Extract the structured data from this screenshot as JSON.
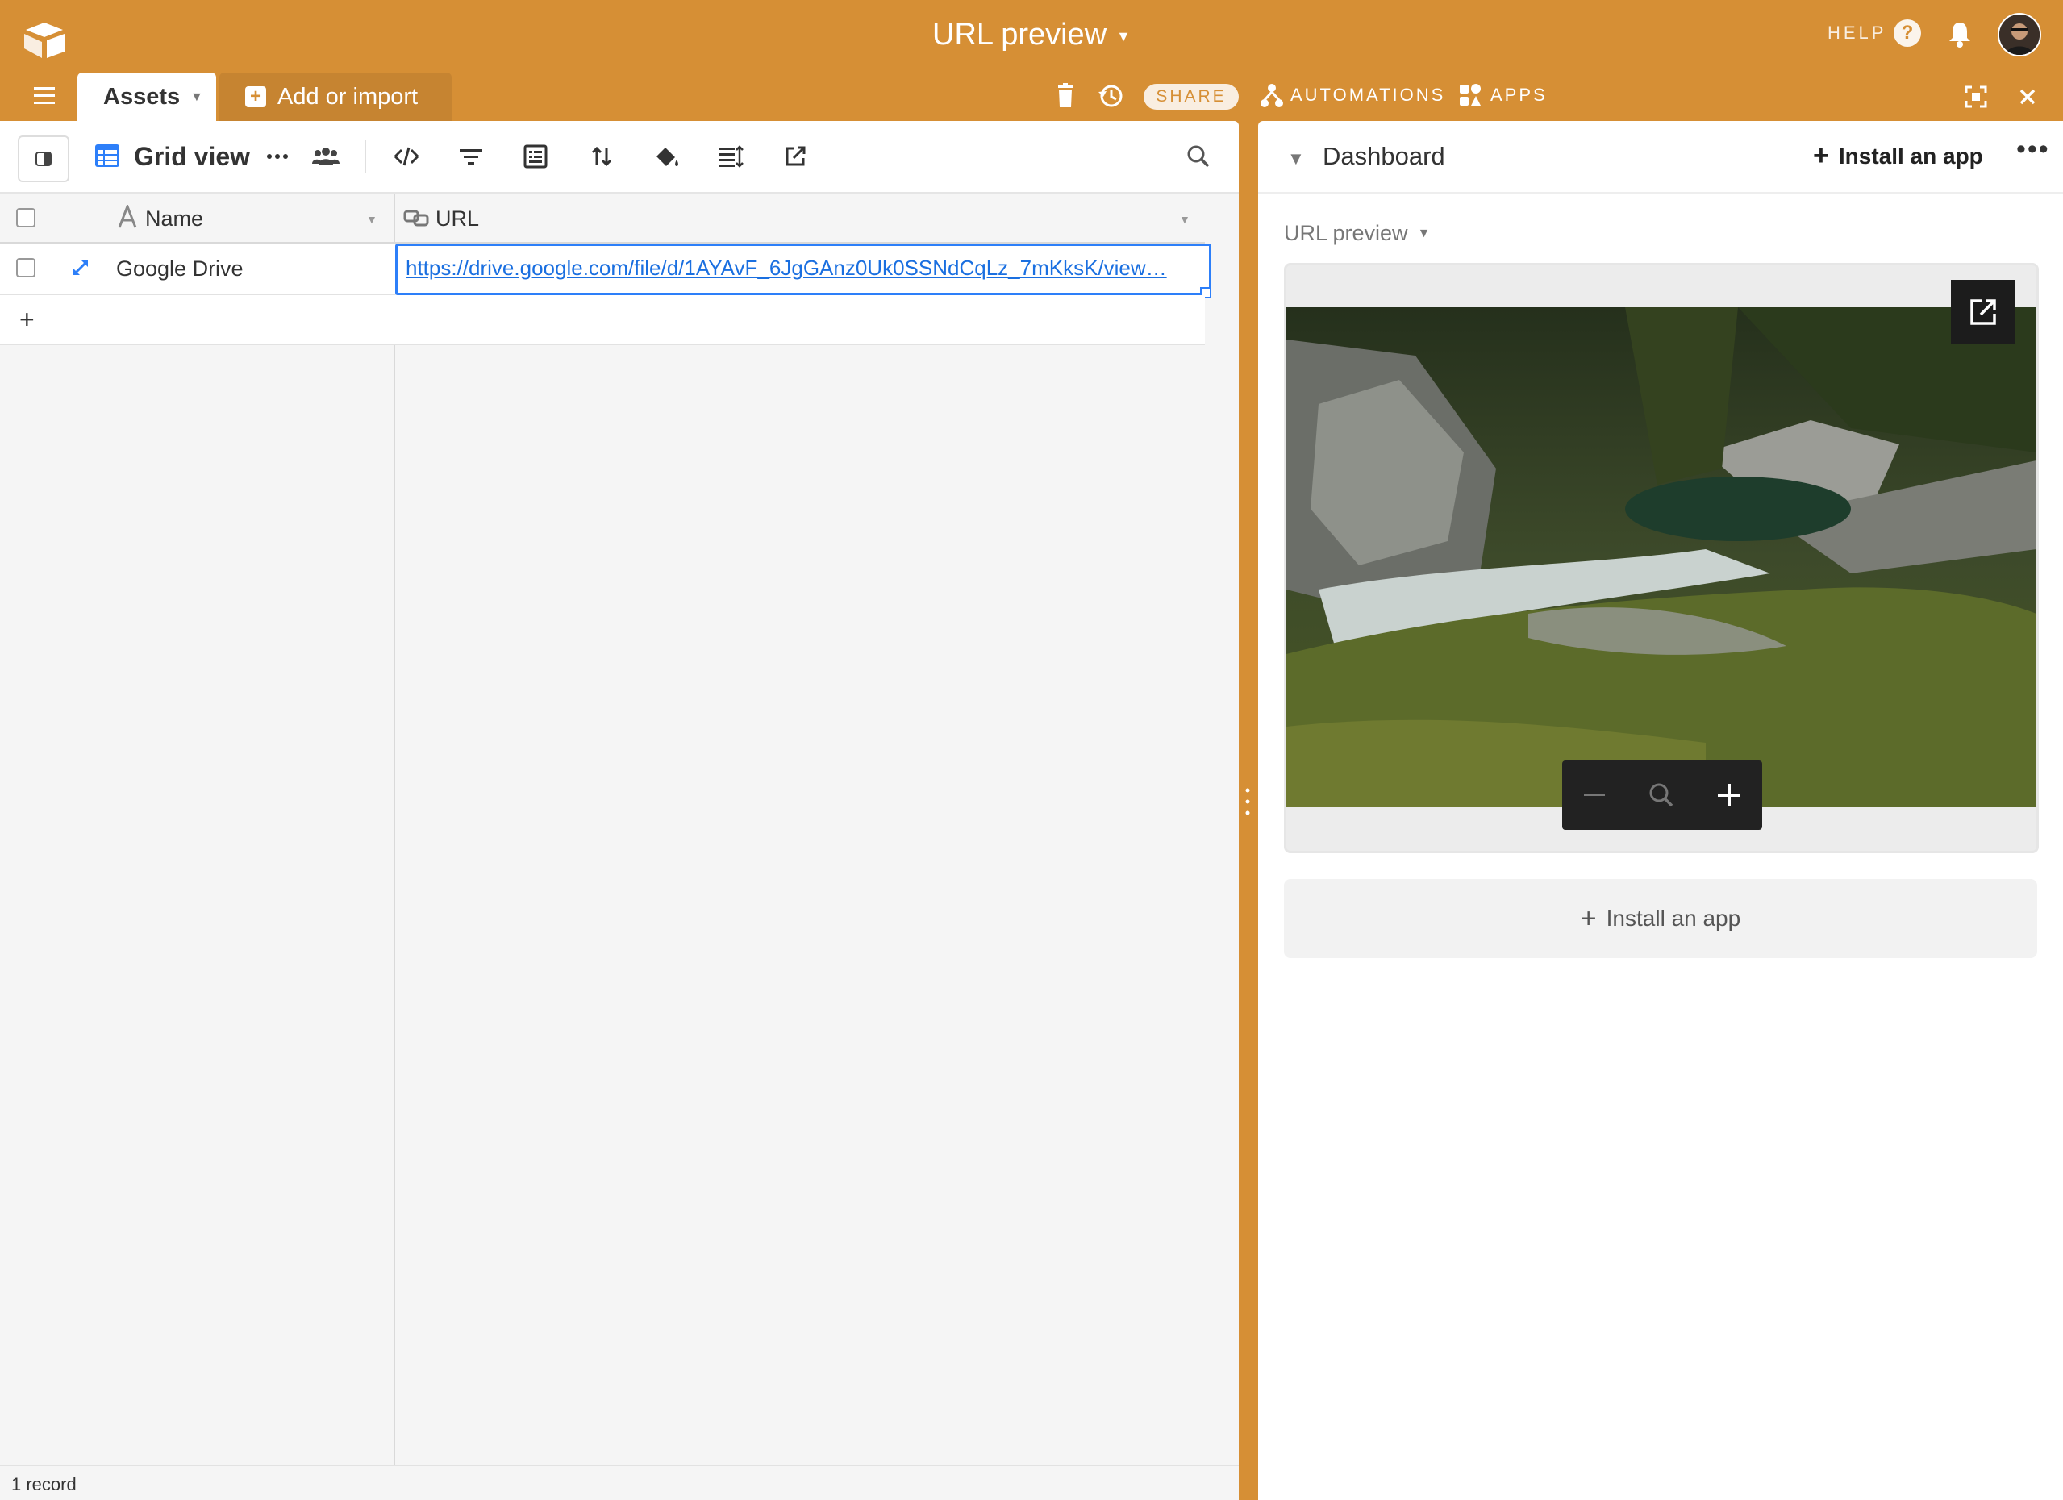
{
  "topbar": {
    "base_title": "URL preview",
    "help_label": "HELP",
    "help_glyph": "?",
    "table_tab": "Assets",
    "add_import": "Add or import",
    "share": "SHARE",
    "automations": "AUTOMATIONS",
    "apps": "APPS",
    "icons": [
      "airtable-logo-icon",
      "help-icon",
      "bell-icon",
      "avatar",
      "menu-icon",
      "trash-icon",
      "history-icon",
      "automations-icon",
      "apps-icon",
      "fullscreen-icon",
      "close-icon"
    ],
    "colors": {
      "brand": "#d68f35",
      "text": "#ffffff"
    }
  },
  "viewbar": {
    "view_name": "Grid view",
    "icons": [
      "sidebar-toggle-icon",
      "grid-view-icon",
      "more-icon",
      "collaborators-icon",
      "hide-fields-icon",
      "filter-icon",
      "group-icon",
      "sort-icon",
      "color-icon",
      "row-height-icon",
      "share-view-icon",
      "search-icon"
    ]
  },
  "grid": {
    "columns": [
      {
        "label": "Name",
        "type_icon": "text-field-icon"
      },
      {
        "label": "URL",
        "type_icon": "url-field-icon"
      }
    ],
    "rows": [
      {
        "name": "Google Drive",
        "url": "https://drive.google.com/file/d/1AYAvF_6JgGAnz0Uk0SSNdCqLz_7mKksK/view…"
      }
    ],
    "add_row_glyph": "+",
    "record_count": "1 record",
    "colors": {
      "selection": "#2d7ff9",
      "link": "#1a6fe0"
    }
  },
  "dashboard": {
    "title": "Dashboard",
    "install_top": "Install an app",
    "more_glyph": "•••",
    "app_label": "URL preview",
    "install_bottom": "Install an app",
    "preview_icon": "open-external-icon",
    "zoom_icons": [
      "zoom-out-icon",
      "zoom-reset-icon",
      "zoom-in-icon"
    ]
  }
}
